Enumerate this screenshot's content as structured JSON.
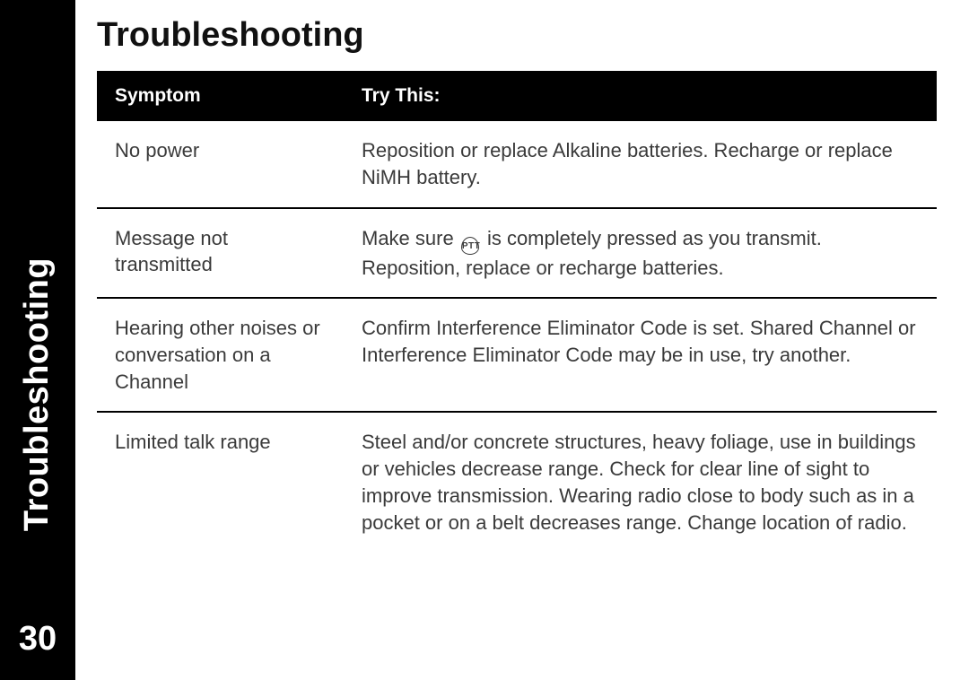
{
  "sidebar": {
    "section_label": "Troubleshooting",
    "page_number": "30"
  },
  "page": {
    "title": "Troubleshooting"
  },
  "table": {
    "headers": {
      "symptom": "Symptom",
      "try_this": "Try This:"
    },
    "rows": [
      {
        "symptom": "No power",
        "try_this_html": "Reposition or replace Alkaline batteries. Recharge or replace NiMH battery."
      },
      {
        "symptom": "Message not transmitted",
        "try_this_pre": "Make sure ",
        "ptt_label": "PTT",
        "try_this_post": " is completely pressed as you transmit. Reposition, replace or recharge batteries."
      },
      {
        "symptom": "Hearing other noises or conversation on a Channel",
        "try_this_html": "Confirm Interference Eliminator Code is set. Shared Channel or Interference Eliminator Code may be in use, try another."
      },
      {
        "symptom": "Limited talk range",
        "try_this_html": "Steel and/or concrete structures, heavy foliage, use in buildings or vehicles decrease range. Check for clear line of sight to improve transmission. Wearing radio close to body such as in a pocket or on a belt decreases range. Change location of radio."
      }
    ]
  }
}
